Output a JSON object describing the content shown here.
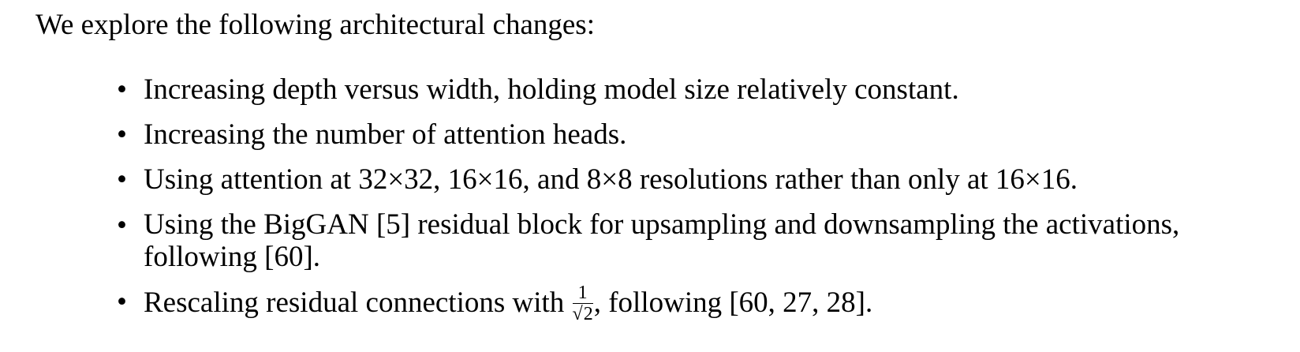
{
  "intro": "We explore the following architectural changes:",
  "bullet_glyph": "•",
  "items": [
    {
      "text": "Increasing depth versus width, holding model size relatively constant."
    },
    {
      "text": "Increasing the number of attention heads."
    },
    {
      "text": "Using attention at 32×32, 16×16, and 8×8 resolutions rather than only at 16×16."
    },
    {
      "text": "Using the BigGAN [5] residual block for upsampling and downsampling the activations, following [60]."
    },
    {
      "text_before": "Rescaling residual connections with ",
      "frac_num": "1",
      "frac_sqrt_sign": "√",
      "frac_radicand": "2",
      "text_after": ", following [60, 27, 28]."
    }
  ]
}
